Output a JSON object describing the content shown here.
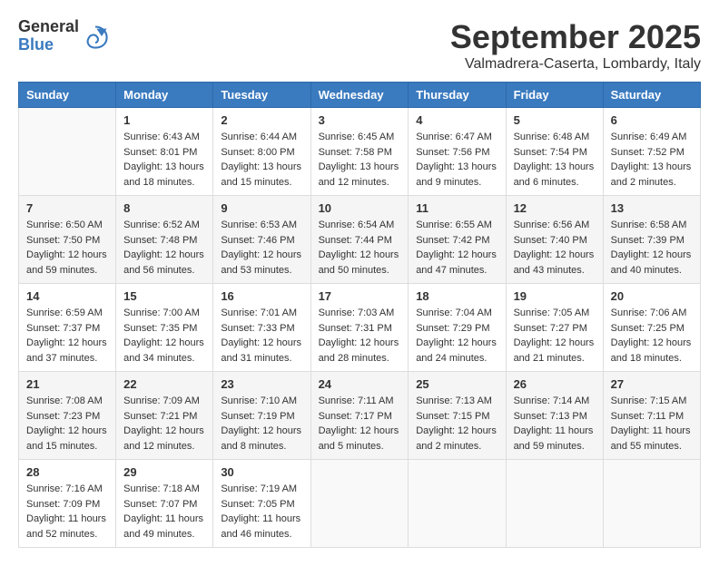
{
  "header": {
    "logo": {
      "general": "General",
      "blue": "Blue"
    },
    "title": "September 2025",
    "location": "Valmadrera-Caserta, Lombardy, Italy"
  },
  "calendar": {
    "weekdays": [
      "Sunday",
      "Monday",
      "Tuesday",
      "Wednesday",
      "Thursday",
      "Friday",
      "Saturday"
    ],
    "weeks": [
      [
        {
          "day": "",
          "empty": true
        },
        {
          "day": "1",
          "sunrise": "6:43 AM",
          "sunset": "8:01 PM",
          "daylight": "13 hours and 18 minutes."
        },
        {
          "day": "2",
          "sunrise": "6:44 AM",
          "sunset": "8:00 PM",
          "daylight": "13 hours and 15 minutes."
        },
        {
          "day": "3",
          "sunrise": "6:45 AM",
          "sunset": "7:58 PM",
          "daylight": "13 hours and 12 minutes."
        },
        {
          "day": "4",
          "sunrise": "6:47 AM",
          "sunset": "7:56 PM",
          "daylight": "13 hours and 9 minutes."
        },
        {
          "day": "5",
          "sunrise": "6:48 AM",
          "sunset": "7:54 PM",
          "daylight": "13 hours and 6 minutes."
        },
        {
          "day": "6",
          "sunrise": "6:49 AM",
          "sunset": "7:52 PM",
          "daylight": "13 hours and 2 minutes."
        }
      ],
      [
        {
          "day": "7",
          "sunrise": "6:50 AM",
          "sunset": "7:50 PM",
          "daylight": "12 hours and 59 minutes."
        },
        {
          "day": "8",
          "sunrise": "6:52 AM",
          "sunset": "7:48 PM",
          "daylight": "12 hours and 56 minutes."
        },
        {
          "day": "9",
          "sunrise": "6:53 AM",
          "sunset": "7:46 PM",
          "daylight": "12 hours and 53 minutes."
        },
        {
          "day": "10",
          "sunrise": "6:54 AM",
          "sunset": "7:44 PM",
          "daylight": "12 hours and 50 minutes."
        },
        {
          "day": "11",
          "sunrise": "6:55 AM",
          "sunset": "7:42 PM",
          "daylight": "12 hours and 47 minutes."
        },
        {
          "day": "12",
          "sunrise": "6:56 AM",
          "sunset": "7:40 PM",
          "daylight": "12 hours and 43 minutes."
        },
        {
          "day": "13",
          "sunrise": "6:58 AM",
          "sunset": "7:39 PM",
          "daylight": "12 hours and 40 minutes."
        }
      ],
      [
        {
          "day": "14",
          "sunrise": "6:59 AM",
          "sunset": "7:37 PM",
          "daylight": "12 hours and 37 minutes."
        },
        {
          "day": "15",
          "sunrise": "7:00 AM",
          "sunset": "7:35 PM",
          "daylight": "12 hours and 34 minutes."
        },
        {
          "day": "16",
          "sunrise": "7:01 AM",
          "sunset": "7:33 PM",
          "daylight": "12 hours and 31 minutes."
        },
        {
          "day": "17",
          "sunrise": "7:03 AM",
          "sunset": "7:31 PM",
          "daylight": "12 hours and 28 minutes."
        },
        {
          "day": "18",
          "sunrise": "7:04 AM",
          "sunset": "7:29 PM",
          "daylight": "12 hours and 24 minutes."
        },
        {
          "day": "19",
          "sunrise": "7:05 AM",
          "sunset": "7:27 PM",
          "daylight": "12 hours and 21 minutes."
        },
        {
          "day": "20",
          "sunrise": "7:06 AM",
          "sunset": "7:25 PM",
          "daylight": "12 hours and 18 minutes."
        }
      ],
      [
        {
          "day": "21",
          "sunrise": "7:08 AM",
          "sunset": "7:23 PM",
          "daylight": "12 hours and 15 minutes."
        },
        {
          "day": "22",
          "sunrise": "7:09 AM",
          "sunset": "7:21 PM",
          "daylight": "12 hours and 12 minutes."
        },
        {
          "day": "23",
          "sunrise": "7:10 AM",
          "sunset": "7:19 PM",
          "daylight": "12 hours and 8 minutes."
        },
        {
          "day": "24",
          "sunrise": "7:11 AM",
          "sunset": "7:17 PM",
          "daylight": "12 hours and 5 minutes."
        },
        {
          "day": "25",
          "sunrise": "7:13 AM",
          "sunset": "7:15 PM",
          "daylight": "12 hours and 2 minutes."
        },
        {
          "day": "26",
          "sunrise": "7:14 AM",
          "sunset": "7:13 PM",
          "daylight": "11 hours and 59 minutes."
        },
        {
          "day": "27",
          "sunrise": "7:15 AM",
          "sunset": "7:11 PM",
          "daylight": "11 hours and 55 minutes."
        }
      ],
      [
        {
          "day": "28",
          "sunrise": "7:16 AM",
          "sunset": "7:09 PM",
          "daylight": "11 hours and 52 minutes."
        },
        {
          "day": "29",
          "sunrise": "7:18 AM",
          "sunset": "7:07 PM",
          "daylight": "11 hours and 49 minutes."
        },
        {
          "day": "30",
          "sunrise": "7:19 AM",
          "sunset": "7:05 PM",
          "daylight": "11 hours and 46 minutes."
        },
        {
          "day": "",
          "empty": true
        },
        {
          "day": "",
          "empty": true
        },
        {
          "day": "",
          "empty": true
        },
        {
          "day": "",
          "empty": true
        }
      ]
    ]
  },
  "labels": {
    "sunrise_prefix": "Sunrise:",
    "sunset_prefix": "Sunset:",
    "daylight_prefix": "Daylight:"
  }
}
